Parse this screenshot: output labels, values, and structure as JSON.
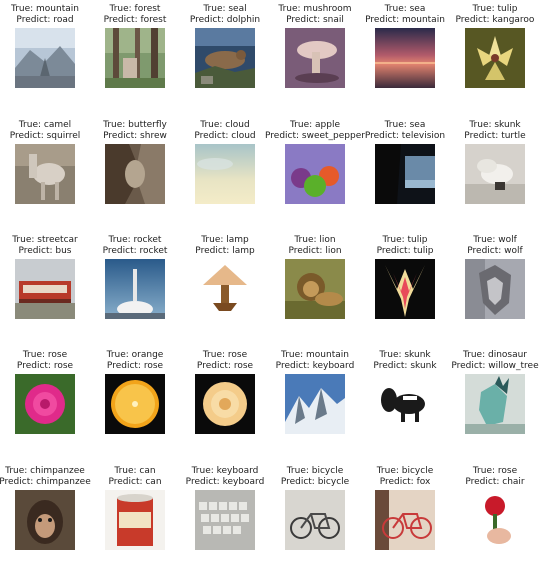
{
  "items": [
    {
      "true_label": "True: mountain",
      "pred_label": "Predict: road",
      "icon": "mountain-road-photo"
    },
    {
      "true_label": "True: forest",
      "pred_label": "Predict: forest",
      "icon": "forest-photo"
    },
    {
      "true_label": "True: seal",
      "pred_label": "Predict: dolphin",
      "icon": "seal-photo"
    },
    {
      "true_label": "True: mushroom",
      "pred_label": "Predict: snail",
      "icon": "mushroom-photo"
    },
    {
      "true_label": "True: sea",
      "pred_label": "Predict: mountain",
      "icon": "sea-sunset-photo"
    },
    {
      "true_label": "True: tulip",
      "pred_label": "Predict: kangaroo",
      "icon": "tulip-photo"
    },
    {
      "true_label": "True: camel",
      "pred_label": "Predict: squirrel",
      "icon": "camel-photo"
    },
    {
      "true_label": "True: butterfly",
      "pred_label": "Predict: shrew",
      "icon": "butterfly-photo"
    },
    {
      "true_label": "True: cloud",
      "pred_label": "Predict: cloud",
      "icon": "cloud-photo"
    },
    {
      "true_label": "True: apple",
      "pred_label": "Predict: sweet_pepper",
      "icon": "apple-photo"
    },
    {
      "true_label": "True: sea",
      "pred_label": "Predict: television",
      "icon": "sea-tree-photo"
    },
    {
      "true_label": "True: skunk",
      "pred_label": "Predict: turtle",
      "icon": "skunk-photo"
    },
    {
      "true_label": "True: streetcar",
      "pred_label": "Predict: bus",
      "icon": "streetcar-photo"
    },
    {
      "true_label": "True: rocket",
      "pred_label": "Predict: rocket",
      "icon": "rocket-photo"
    },
    {
      "true_label": "True: lamp",
      "pred_label": "Predict: lamp",
      "icon": "lamp-photo"
    },
    {
      "true_label": "True: lion",
      "pred_label": "Predict: lion",
      "icon": "lion-photo"
    },
    {
      "true_label": "True: tulip",
      "pred_label": "Predict: tulip",
      "icon": "tulip-closeup-photo"
    },
    {
      "true_label": "True: wolf",
      "pred_label": "Predict: wolf",
      "icon": "wolf-photo"
    },
    {
      "true_label": "True: rose",
      "pred_label": "Predict: rose",
      "icon": "pink-rose-photo"
    },
    {
      "true_label": "True: orange",
      "pred_label": "Predict: rose",
      "icon": "orange-slice-photo"
    },
    {
      "true_label": "True: rose",
      "pred_label": "Predict: rose",
      "icon": "yellow-rose-photo"
    },
    {
      "true_label": "True: mountain",
      "pred_label": "Predict: keyboard",
      "icon": "snowy-mountain-photo"
    },
    {
      "true_label": "True: skunk",
      "pred_label": "Predict: skunk",
      "icon": "skunk-drawing-photo"
    },
    {
      "true_label": "True: dinosaur",
      "pred_label": "Predict: willow_tree",
      "icon": "dinosaur-photo"
    },
    {
      "true_label": "True: chimpanzee",
      "pred_label": "Predict: chimpanzee",
      "icon": "chimpanzee-photo"
    },
    {
      "true_label": "True: can",
      "pred_label": "Predict: can",
      "icon": "can-photo"
    },
    {
      "true_label": "True: keyboard",
      "pred_label": "Predict: keyboard",
      "icon": "keyboard-photo"
    },
    {
      "true_label": "True: bicycle",
      "pred_label": "Predict: bicycle",
      "icon": "bicycle-photo"
    },
    {
      "true_label": "True: bicycle",
      "pred_label": "Predict: fox",
      "icon": "red-bicycle-photo"
    },
    {
      "true_label": "True: rose",
      "pred_label": "Predict: chair",
      "icon": "rose-in-hand-photo"
    }
  ]
}
